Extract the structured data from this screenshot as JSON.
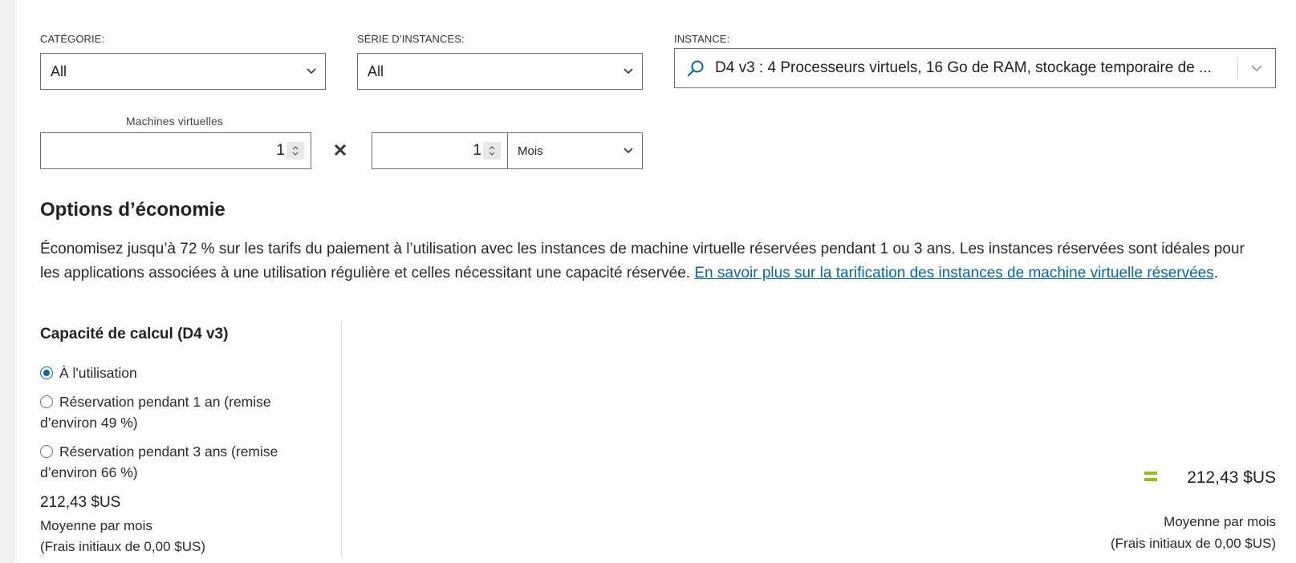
{
  "filters": {
    "category": {
      "label": "CATÉGORIE:",
      "value": "All"
    },
    "series": {
      "label": "SÉRIE D’INSTANCES:",
      "value": "All"
    },
    "instance": {
      "label": "INSTANCE:",
      "value": "D4 v3 : 4 Processeurs virtuels, 16 Go de RAM, stockage temporaire de ..."
    }
  },
  "quantity": {
    "vm_label": "Machines virtuelles",
    "vm_count": "1",
    "duration": "1",
    "unit": "Mois"
  },
  "savings": {
    "heading": "Options d’économie",
    "description": "Économisez jusqu’à 72 % sur les tarifs du paiement à l’utilisation avec les instances de machine virtuelle réservées pendant 1 ou 3 ans. Les instances réservées sont idéales pour les applications associées à une utilisation régulière et celles nécessitant une capacité réservée.",
    "link": "En savoir plus sur la tarification des instances de machine virtuelle réservées",
    "period": "."
  },
  "compute": {
    "title": "Capacité de calcul (D4 v3)",
    "options": [
      {
        "label": "À l'utilisation",
        "checked": true
      },
      {
        "label": "Réservation pendant 1 an (remise d’environ 49 %)",
        "checked": false
      },
      {
        "label": "Réservation pendant 3 ans (remise d’environ 66 %)",
        "checked": false
      }
    ],
    "price": "212,43 $US",
    "avg": "Moyenne par mois",
    "upfront": "(Frais initiaux de 0,00 $US)"
  },
  "total": {
    "value": "212,43 $US",
    "avg": "Moyenne par mois",
    "upfront": "(Frais initiaux de 0,00 $US)"
  },
  "colors": {
    "accent": "#0067b8",
    "equals": "#8cc01b"
  }
}
